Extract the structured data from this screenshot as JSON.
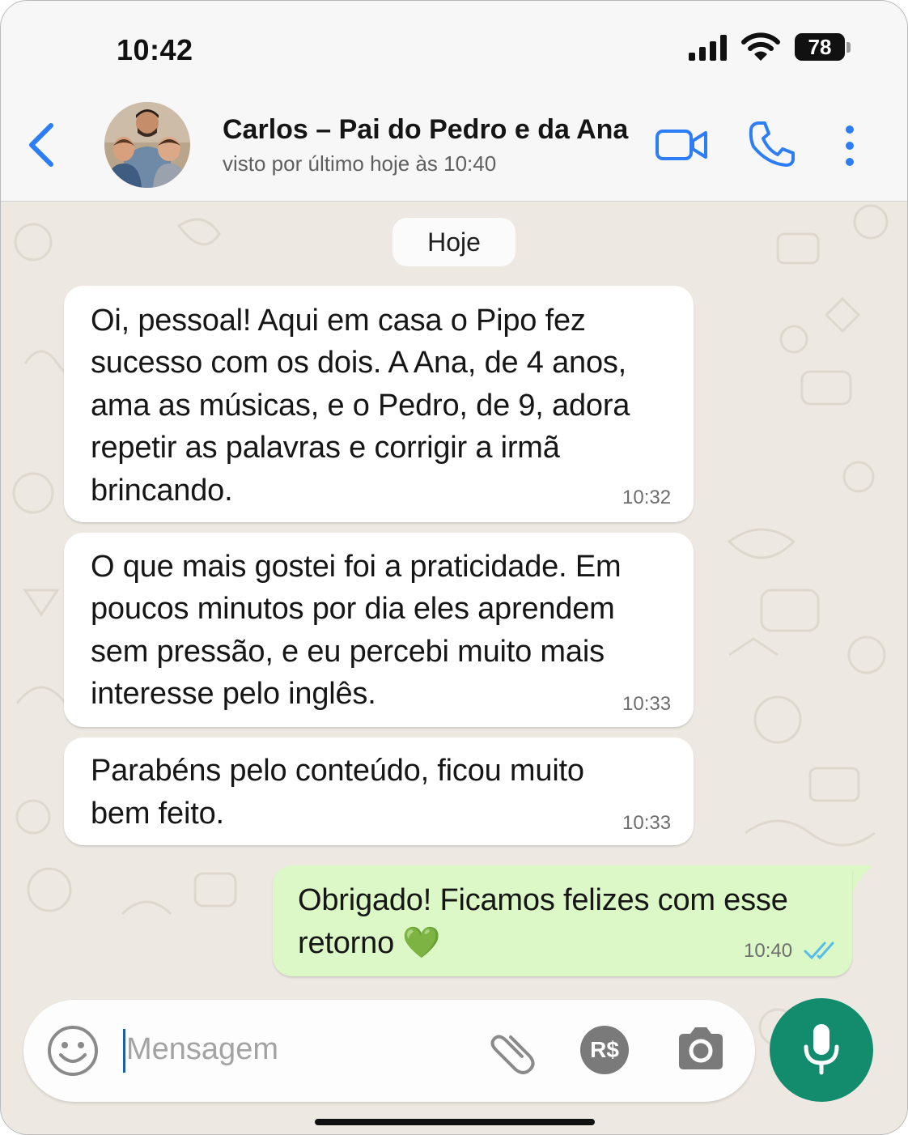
{
  "status_bar": {
    "time": "10:42",
    "battery": "78",
    "icons": [
      "signal-icon",
      "wifi-icon",
      "battery-icon"
    ]
  },
  "header": {
    "contact_name": "Carlos – Pai do Pedro e da Ana",
    "last_seen": "visto por último hoje às 10:40",
    "icons": [
      "back-arrow-icon",
      "avatar",
      "video-call-icon",
      "phone-call-icon",
      "more-options-icon"
    ],
    "accent_color": "#2d7df6"
  },
  "chat": {
    "date_label": "Hoje",
    "messages": [
      {
        "direction": "incoming",
        "lines": [
          "Oi, pessoal! Aqui em casa o Pipo fez",
          "sucesso com os dois. A Ana, de 4 anos,",
          "ama as músicas, e o Pedro, de 9, adora",
          "repetir as palavras e corrigir a irmã",
          "brincando."
        ],
        "time": "10:32"
      },
      {
        "direction": "incoming",
        "lines": [
          "O que mais gostei foi a praticidade. Em",
          "poucos minutos por dia eles aprendem",
          "sem pressão, e eu percebi muito mais",
          "interesse pelo inglês."
        ],
        "time": "10:33"
      },
      {
        "direction": "incoming",
        "lines": [
          "Parabéns pelo conteúdo, ficou muito",
          "bem feito."
        ],
        "time": "10:33"
      },
      {
        "direction": "outgoing",
        "lines": [
          "Obrigado! Ficamos felizes com esse",
          "retorno 💚"
        ],
        "time": "10:40",
        "status": "read"
      }
    ],
    "outgoing_bubble_color": "#dcf8c6",
    "incoming_bubble_color": "#ffffff",
    "wallpaper_color": "#ede8e1"
  },
  "composer": {
    "placeholder": "Mensagem",
    "payment_label": "R$",
    "icons": [
      "emoji-icon",
      "attach-icon",
      "payment-icon",
      "camera-icon",
      "microphone-icon"
    ],
    "mic_button_color": "#128c6d"
  }
}
